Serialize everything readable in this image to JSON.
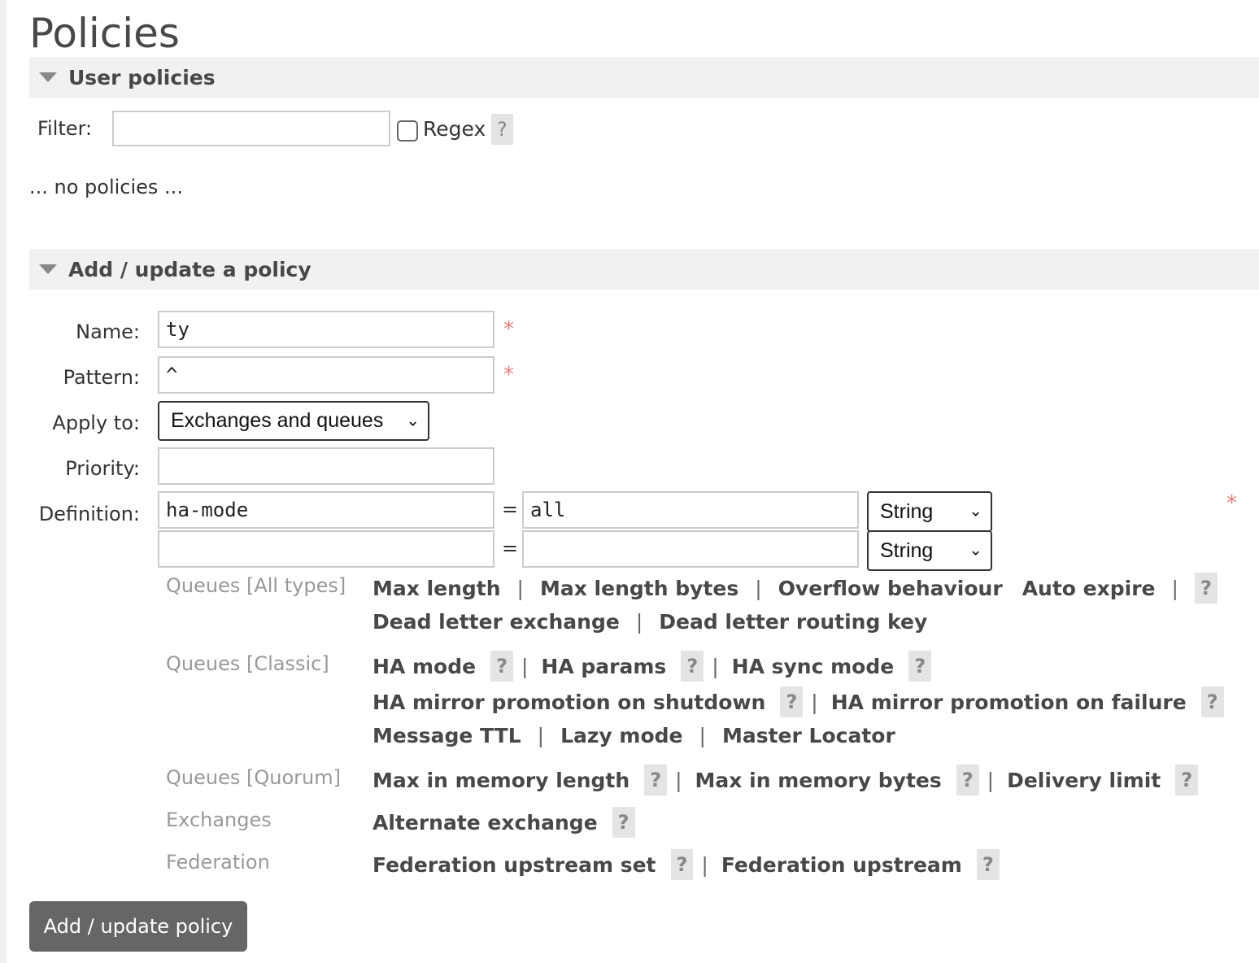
{
  "page": {
    "title": "Policies"
  },
  "user_policies": {
    "header": "User policies",
    "filter_label": "Filter:",
    "filter_value": "",
    "regex_label": "Regex",
    "help": "?",
    "empty_text": "... no policies ..."
  },
  "add_policy": {
    "header": "Add / update a policy",
    "name_label": "Name:",
    "name_value": "ty",
    "pattern_label": "Pattern:",
    "pattern_value": "^",
    "apply_label": "Apply to:",
    "apply_value": "Exchanges and queues",
    "priority_label": "Priority:",
    "priority_value": "",
    "definition_label": "Definition:",
    "required_mark": "*",
    "eq": "=",
    "definitions": [
      {
        "key": "ha-mode",
        "value": "all",
        "type": "String"
      },
      {
        "key": "",
        "value": "",
        "type": "String"
      }
    ],
    "groups": {
      "all_types": {
        "label": "Queues [All types]",
        "items": [
          "Max length",
          "Max length bytes",
          "Overflow behaviour",
          "Auto expire",
          "Dead letter exchange",
          "Dead letter routing key"
        ]
      },
      "classic": {
        "label": "Queues [Classic]",
        "items": [
          "HA mode",
          "HA params",
          "HA sync mode",
          "HA mirror promotion on shutdown",
          "HA mirror promotion on failure",
          "Message TTL",
          "Lazy mode",
          "Master Locator"
        ]
      },
      "quorum": {
        "label": "Queues [Quorum]",
        "items": [
          "Max in memory length",
          "Max in memory bytes",
          "Delivery limit"
        ]
      },
      "exchanges": {
        "label": "Exchanges",
        "items": [
          "Alternate exchange"
        ]
      },
      "federation": {
        "label": "Federation",
        "items": [
          "Federation upstream set",
          "Federation upstream"
        ]
      }
    },
    "separator": "|",
    "submit_label": "Add / update policy"
  }
}
